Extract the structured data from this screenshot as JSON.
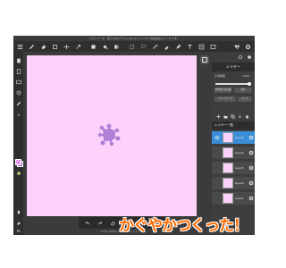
{
  "hint_text": "ブラシツール：柔らかなブラシによりキャンバスに自由自在にツールです。",
  "toolbar": {
    "tools": [
      "menu-icon",
      "brush-icon",
      "eraser-icon",
      "rectangle-icon",
      "move-icon",
      "transform-icon",
      "fill-rect-icon",
      "bucket-icon",
      "gradient-icon",
      "selection-icon",
      "lasso-icon",
      "magic-wand-icon",
      "eyedropper-icon",
      "pen-icon",
      "text-icon",
      "layer-effect-icon",
      "frame-icon"
    ]
  },
  "right_panel": {
    "title": "レイヤー",
    "opacity_label": "不透明度",
    "opacity_value": "100%",
    "opacity": 1.0,
    "blend_mode": "通常",
    "protect_label": "透明部分を保護",
    "clipping_label": "クリッピング",
    "lock_label": "ロック",
    "layers_header": "レイヤー一覧",
    "layers": [
      {
        "name": "Layer5",
        "visible": true,
        "selected": true
      },
      {
        "name": "Layer4",
        "visible": false,
        "selected": false
      },
      {
        "name": "Layer3",
        "visible": false,
        "selected": false
      },
      {
        "name": "Layer2",
        "visible": false,
        "selected": false
      },
      {
        "name": "Layer1",
        "visible": false,
        "selected": false
      }
    ]
  },
  "colors": {
    "canvas": "#fcd2fd",
    "splat": "#b07fd6",
    "accent": "#3a8ed8",
    "caption": "#ff6a00"
  },
  "status_text": "2732×2048px 350dpi 25% ブラシ 30px",
  "caption": "かぐやかつくった！"
}
